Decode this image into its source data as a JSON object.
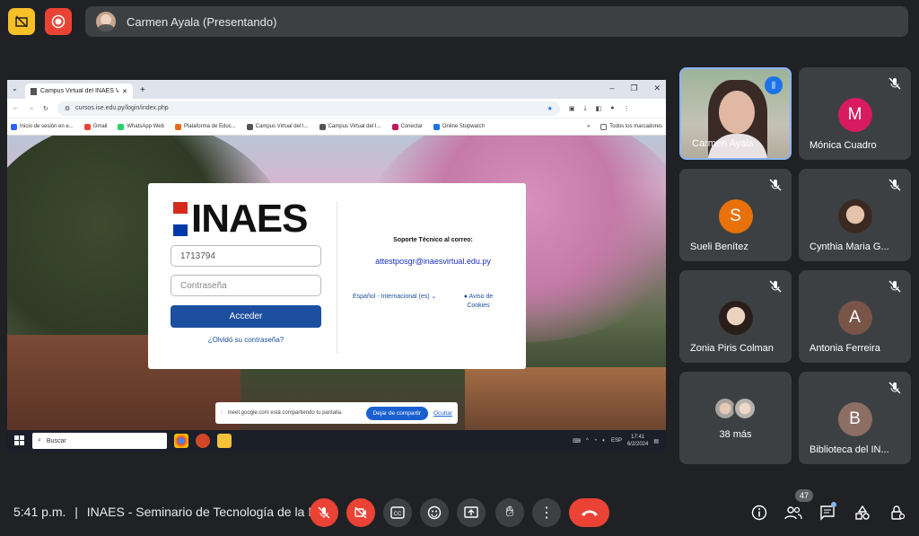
{
  "top": {
    "presenter_label": "Carmen Ayala (Presentando)"
  },
  "shared_screen": {
    "tab_title": "Campus Virtual del INAES Versi",
    "url": "cursos.ise.edu.py/login/index.php",
    "bookmarks": [
      "Inicio de sesión en e...",
      "Gmail",
      "WhatsApp Web",
      "Plataforma de Educ...",
      "Campus Virtual del I...",
      "Campus Virtual del I...",
      "Conectar",
      "Online Stopwatch"
    ],
    "bookmarks_all": "Todos los marcadores",
    "login": {
      "logo_text": "INAES",
      "username_value": "1713794",
      "password_placeholder": "Contraseña",
      "access_button": "Acceder",
      "forgot_link": "¿Olvidó su contraseña?",
      "support_label": "Soporte Técnico al correo:",
      "support_email": "attestposgr@inaesvirtual.edu.py",
      "language": "Español - Internacional (es)",
      "cookies": "Aviso de Cookies"
    },
    "share_notice": {
      "text": "meet.google.com está compartiendo tu pantalla.",
      "stop_button": "Dejar de compartir",
      "hide_link": "Ocultar"
    },
    "taskbar": {
      "search_placeholder": "Buscar",
      "lang": "ESP",
      "time": "17:41",
      "date": "6/2/2024"
    }
  },
  "participants": [
    {
      "name": "Carmen Ayala",
      "speaking": true
    },
    {
      "name": "Mónica Cuadro",
      "initial": "M",
      "color": "#d81b60"
    },
    {
      "name": "Sueli Benítez",
      "initial": "S",
      "color": "#e8710a"
    },
    {
      "name": "Cynthia Maria G..."
    },
    {
      "name": "Zonia Piris Colman"
    },
    {
      "name": "Antonia Ferreira",
      "initial": "A",
      "color": "#795548"
    },
    {
      "name": "38 más"
    },
    {
      "name": "Biblioteca del IN...",
      "initial": "B",
      "color": "#8d6e63"
    }
  ],
  "bottom": {
    "time": "5:41 p.m.",
    "separator": "|",
    "meeting_title": "INAES - Seminario de Tecnología de la I...",
    "people_count": "47"
  }
}
